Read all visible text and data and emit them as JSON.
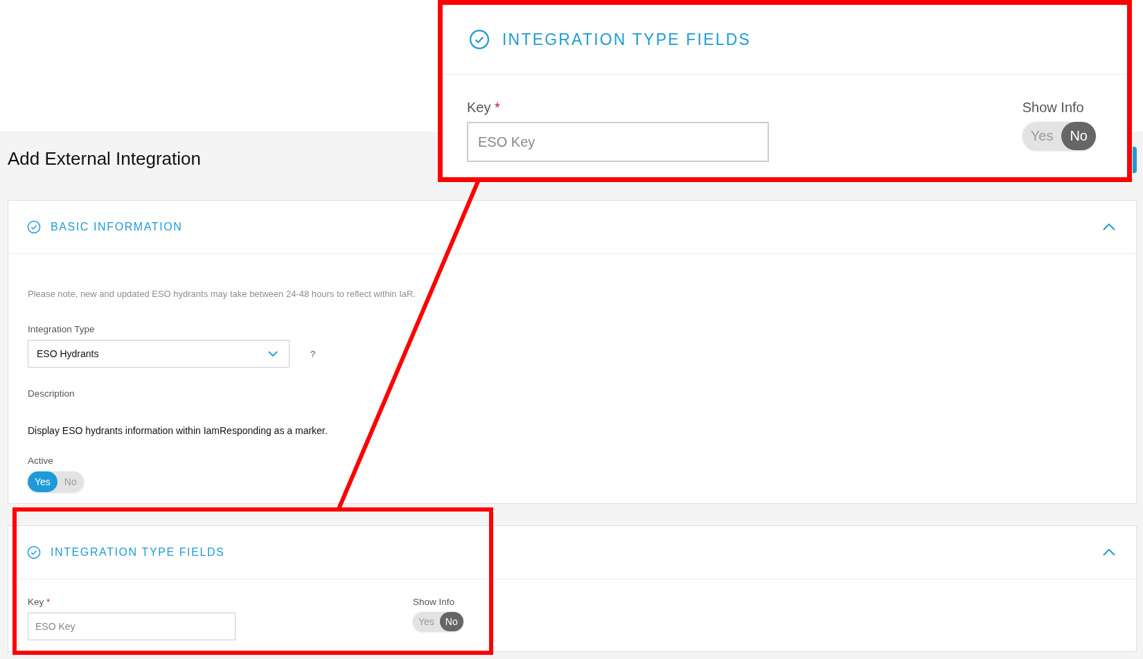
{
  "page_title": "Add External Integration",
  "basic_information": {
    "title": "BASIC INFORMATION",
    "expanded": true,
    "note": "Please note, new and updated ESO hydrants may take between 24-48 hours to reflect within IaR.",
    "integration_type": {
      "label": "Integration Type",
      "value": "ESO Hydrants",
      "help": "?"
    },
    "description": {
      "label": "Description",
      "text": "Display ESO hydrants information within IamResponding as a marker."
    },
    "active": {
      "label": "Active",
      "options": [
        {
          "label": "Yes",
          "selected": true
        },
        {
          "label": "No",
          "selected": false
        }
      ]
    }
  },
  "integration_type_fields": {
    "title": "INTEGRATION TYPE FIELDS",
    "expanded": true,
    "key": {
      "label": "Key",
      "required_mark": "*",
      "placeholder": "ESO Key"
    },
    "show_info": {
      "label": "Show Info",
      "options": [
        {
          "label": "Yes",
          "selected": false
        },
        {
          "label": "No",
          "selected": true
        }
      ]
    }
  },
  "callout": {
    "title": "INTEGRATION TYPE FIELDS",
    "key": {
      "label": "Key",
      "required_mark": "*",
      "placeholder": "ESO Key"
    },
    "show_info": {
      "label": "Show Info",
      "options": [
        {
          "label": "Yes",
          "selected": false
        },
        {
          "label": "No",
          "selected": true
        }
      ]
    }
  }
}
